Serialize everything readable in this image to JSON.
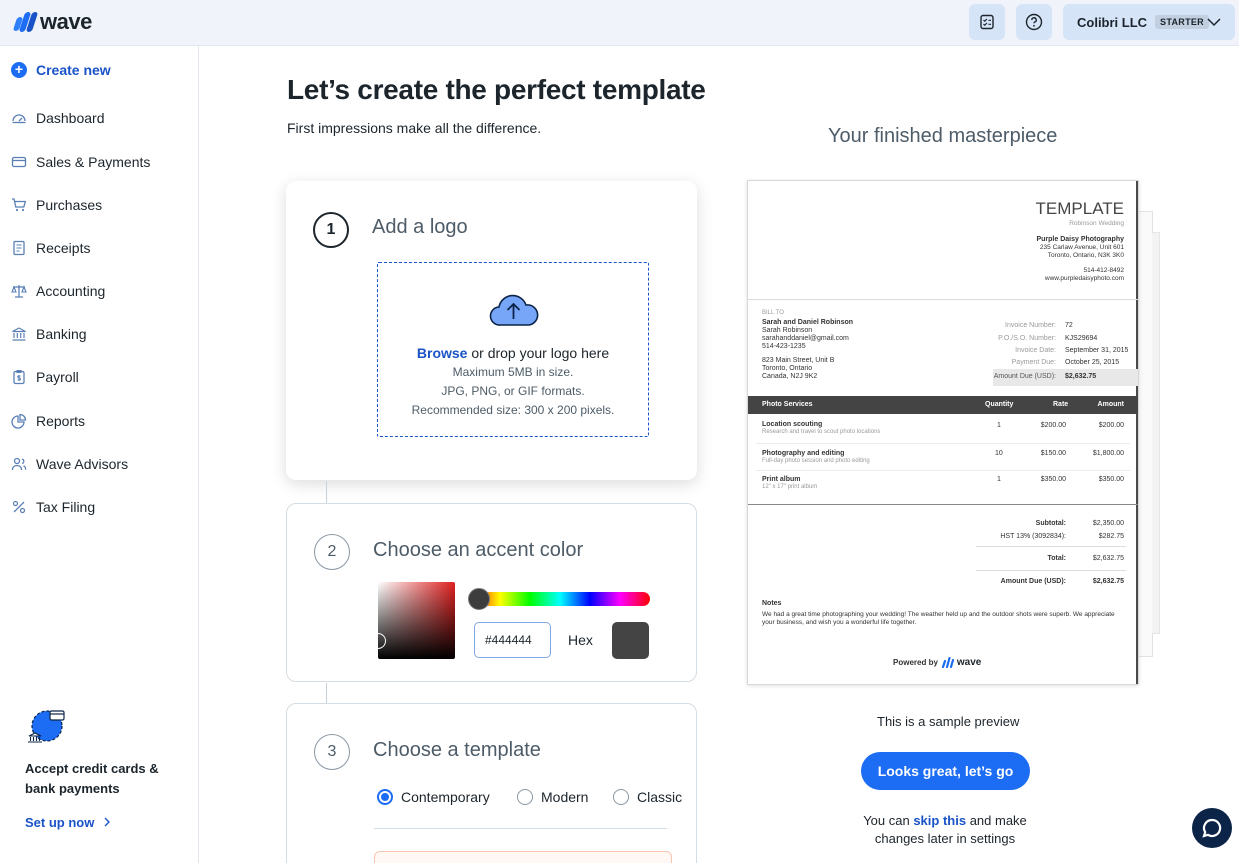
{
  "topbar": {
    "brand": "wave",
    "business_name": "Colibri LLC",
    "plan": "STARTER"
  },
  "sidebar": {
    "create_new": "Create new",
    "items": [
      {
        "label": "Dashboard",
        "icon": "dashboard-icon"
      },
      {
        "label": "Sales & Payments",
        "icon": "credit-card-icon"
      },
      {
        "label": "Purchases",
        "icon": "cart-icon"
      },
      {
        "label": "Receipts",
        "icon": "receipt-icon"
      },
      {
        "label": "Accounting",
        "icon": "scale-icon"
      },
      {
        "label": "Banking",
        "icon": "bank-icon"
      },
      {
        "label": "Payroll",
        "icon": "payroll-icon"
      },
      {
        "label": "Reports",
        "icon": "pie-chart-icon"
      },
      {
        "label": "Wave Advisors",
        "icon": "advisors-icon"
      },
      {
        "label": "Tax Filing",
        "icon": "percent-icon"
      }
    ],
    "promo": {
      "title": "Accept credit cards & bank payments",
      "link": "Set up now"
    }
  },
  "main": {
    "title": "Let’s create the perfect template",
    "subtitle": "First impressions make all the difference.",
    "steps": [
      {
        "number": "1",
        "title": "Add a logo",
        "browse": "Browse",
        "drop_text": " or drop your logo here",
        "max_size": "Maximum 5MB in size.",
        "formats": "JPG, PNG, or GIF formats.",
        "recommended": "Recommended size: 300 x 200 pixels."
      },
      {
        "number": "2",
        "title": "Choose an accent color",
        "hex_value": "#444444",
        "hex_label": "Hex",
        "accent_color": "#444444"
      },
      {
        "number": "3",
        "title": "Choose a template",
        "options": [
          "Contemporary",
          "Modern",
          "Classic"
        ],
        "selected": "Contemporary"
      }
    ]
  },
  "preview": {
    "heading": "Your finished masterpiece",
    "sample_text": "This is a sample preview",
    "cta": "Looks great, let’s go",
    "skip_prefix": "You can ",
    "skip_link": "skip this",
    "skip_suffix": " and make changes later in settings",
    "invoice": {
      "title": "TEMPLATE",
      "subtitle": "Robinson Wedding",
      "company": "Purple Daisy Photography",
      "company_addr1": "235 Carlaw Avenue, Unit 601",
      "company_addr2": "Toronto, Ontario, N3K 3K0",
      "company_phone": "514-412-8492",
      "company_web": "www.purpledaisyphoto.com",
      "bill_to_label": "BILL TO",
      "client_name": "Sarah and Daniel Robinson",
      "client_contact": "Sarah Robinson",
      "client_email": "sarahanddaniel@gmail.com",
      "client_phone": "514-423-1235",
      "client_addr1": "823 Main Street, Unit B",
      "client_addr2": "Toronto, Ontario",
      "client_addr3": "Canada, N2J 9K2",
      "meta": [
        {
          "label": "Invoice Number:",
          "value": "72"
        },
        {
          "label": "P.O./S.O. Number:",
          "value": "KJS29694"
        },
        {
          "label": "Invoice Date:",
          "value": "September 31, 2015"
        },
        {
          "label": "Payment Due:",
          "value": "October 25, 2015"
        }
      ],
      "amount_due_label": "Amount Due (USD):",
      "amount_due_value": "$2,632.75",
      "columns": [
        "Photo Services",
        "Quantity",
        "Rate",
        "Amount"
      ],
      "rows": [
        {
          "name": "Location scouting",
          "desc": "Research and travel to scout photo locations",
          "qty": "1",
          "rate": "$200.00",
          "amount": "$200.00"
        },
        {
          "name": "Photography and editing",
          "desc": "Full-day photo session and photo editing",
          "qty": "10",
          "rate": "$150.00",
          "amount": "$1,800.00"
        },
        {
          "name": "Print album",
          "desc": "12\" x 17\" print album",
          "qty": "1",
          "rate": "$350.00",
          "amount": "$350.00"
        }
      ],
      "subtotal_label": "Subtotal:",
      "subtotal": "$2,350.00",
      "tax_label": "HST 13% (3092834):",
      "tax": "$282.75",
      "total_label": "Total:",
      "total": "$2,632.75",
      "due_label": "Amount Due (USD):",
      "due": "$2,632.75",
      "notes_label": "Notes",
      "notes": "We had a great time photographing your wedding! The weather held up and the outdoor shots were superb. We appreciate your business, and wish you a wonderful life together.",
      "powered_by": "Powered by",
      "powered_brand": "wave"
    }
  }
}
